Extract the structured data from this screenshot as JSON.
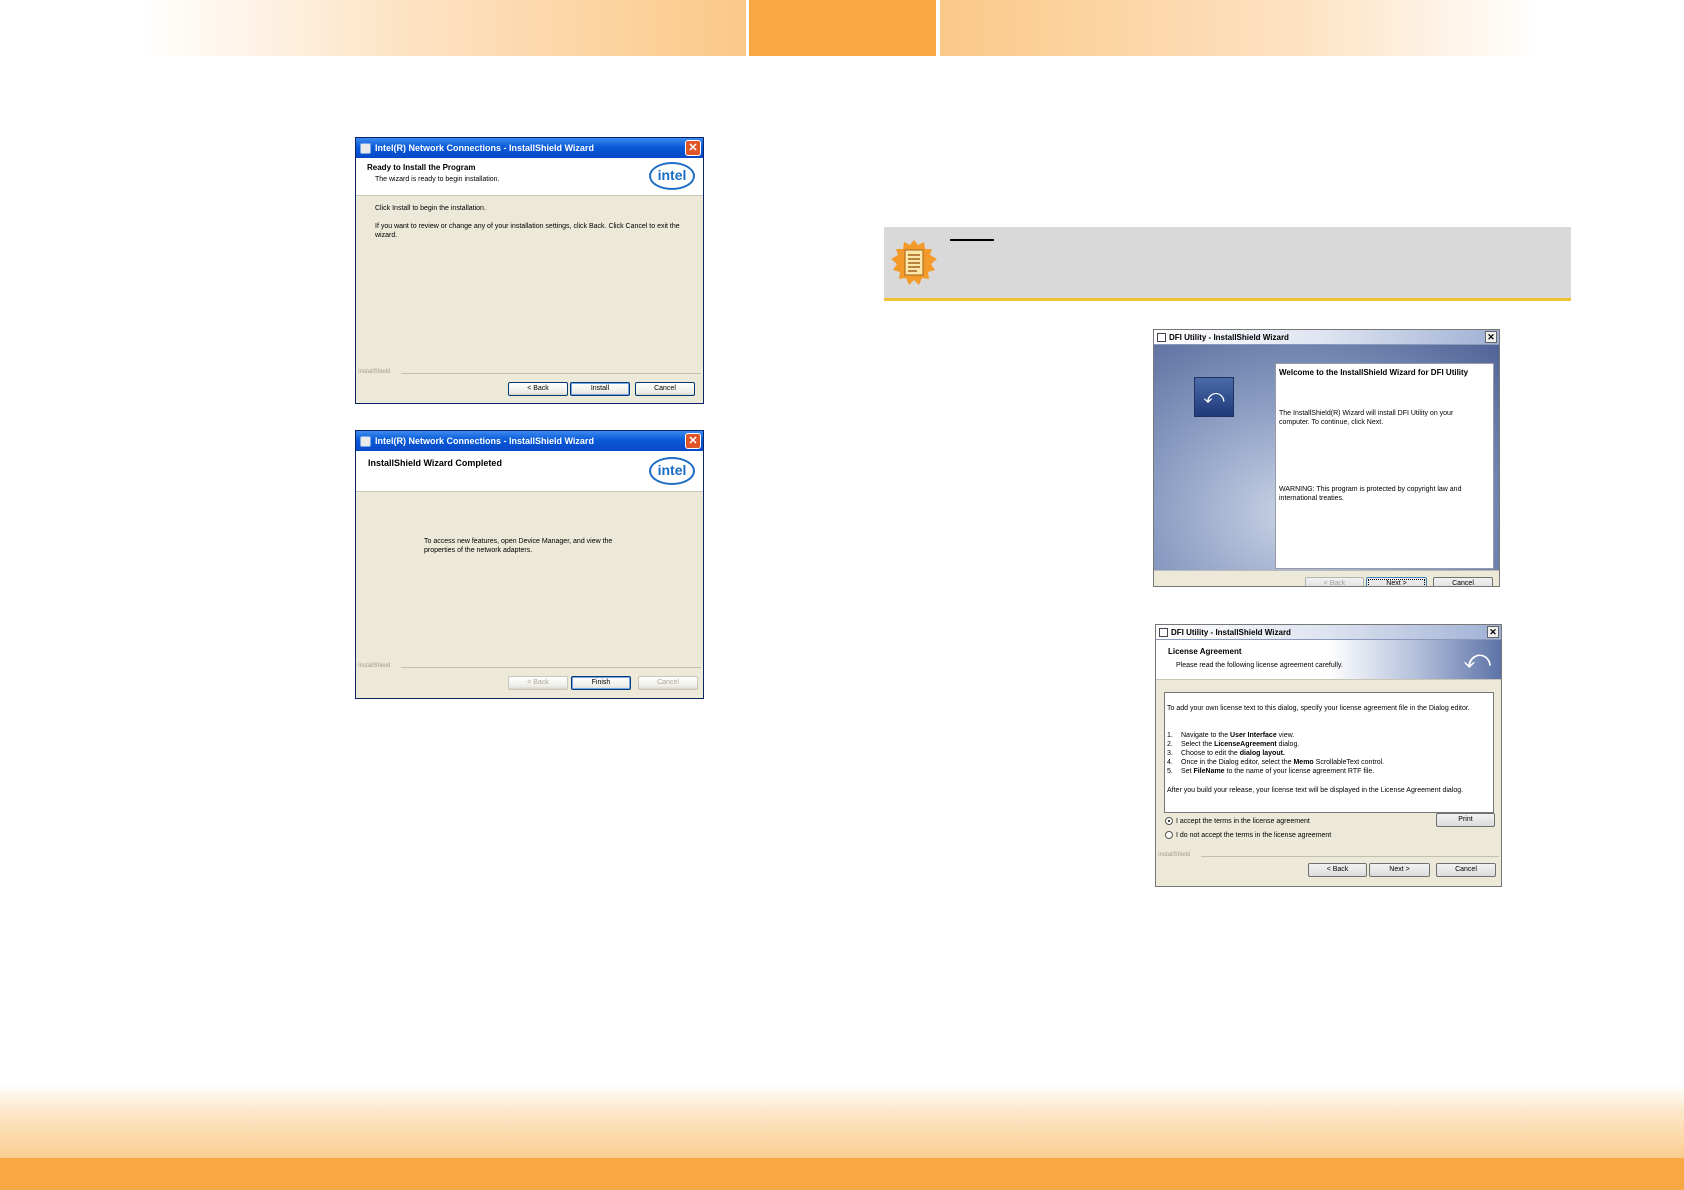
{
  "dialog_intel_ready": {
    "title": "Intel(R) Network Connections - InstallShield Wizard",
    "heading": "Ready to Install the Program",
    "subheading": "The wizard is ready to begin installation.",
    "line1": "Click Install to begin the installation.",
    "line2": "If you want to review or change any of your installation settings, click Back. Click Cancel to exit the wizard.",
    "brand": "InstallShield",
    "logo": "intel",
    "back": "< Back",
    "install": "Install",
    "cancel": "Cancel"
  },
  "dialog_intel_done": {
    "title": "Intel(R) Network Connections - InstallShield Wizard",
    "heading": "InstallShield Wizard Completed",
    "body": "To access new features, open Device Manager, and view the properties of the network adapters.",
    "brand": "InstallShield",
    "logo": "intel",
    "back": "< Back",
    "finish": "Finish",
    "cancel": "Cancel"
  },
  "note": {
    "icon": "note-icon"
  },
  "dialog_dfi_welcome": {
    "title": "DFI Utility - InstallShield Wizard",
    "heading": "Welcome to the InstallShield Wizard for DFI Utility",
    "body": "The InstallShield(R) Wizard will install DFI Utility on your computer. To continue, click Next.",
    "warning": "WARNING: This program is protected by copyright law and international treaties.",
    "back": "< Back",
    "next": "Next >",
    "cancel": "Cancel"
  },
  "dialog_dfi_license": {
    "title": "DFI Utility - InstallShield Wizard",
    "heading": "License Agreement",
    "subheading": "Please read the following license agreement carefully.",
    "intro": "To add your own license text to this dialog, specify your license agreement file in the Dialog editor.",
    "steps": [
      {
        "num": "1.",
        "pre": "Navigate to the ",
        "bold": "User Interface",
        "post": " view."
      },
      {
        "num": "2.",
        "pre": "Select the ",
        "bold": "LicenseAgreement",
        "post": " dialog."
      },
      {
        "num": "3.",
        "pre": "Choose to edit the ",
        "bold": "dialog layout.",
        "post": ""
      },
      {
        "num": "4.",
        "pre": "Once in the Dialog editor, select the ",
        "bold": "Memo",
        "post": " ScrollableText control."
      },
      {
        "num": "5.",
        "pre": "Set ",
        "bold": "FileName",
        "post": " to the name of your license agreement RTF file."
      }
    ],
    "outro": "After you build your release, your license text will be displayed in the License Agreement dialog.",
    "accept": "I accept the terms in the license agreement",
    "decline": "I do not accept the terms in the license agreement",
    "print": "Print",
    "brand": "InstallShield",
    "back": "< Back",
    "next": "Next >",
    "cancel": "Cancel"
  }
}
